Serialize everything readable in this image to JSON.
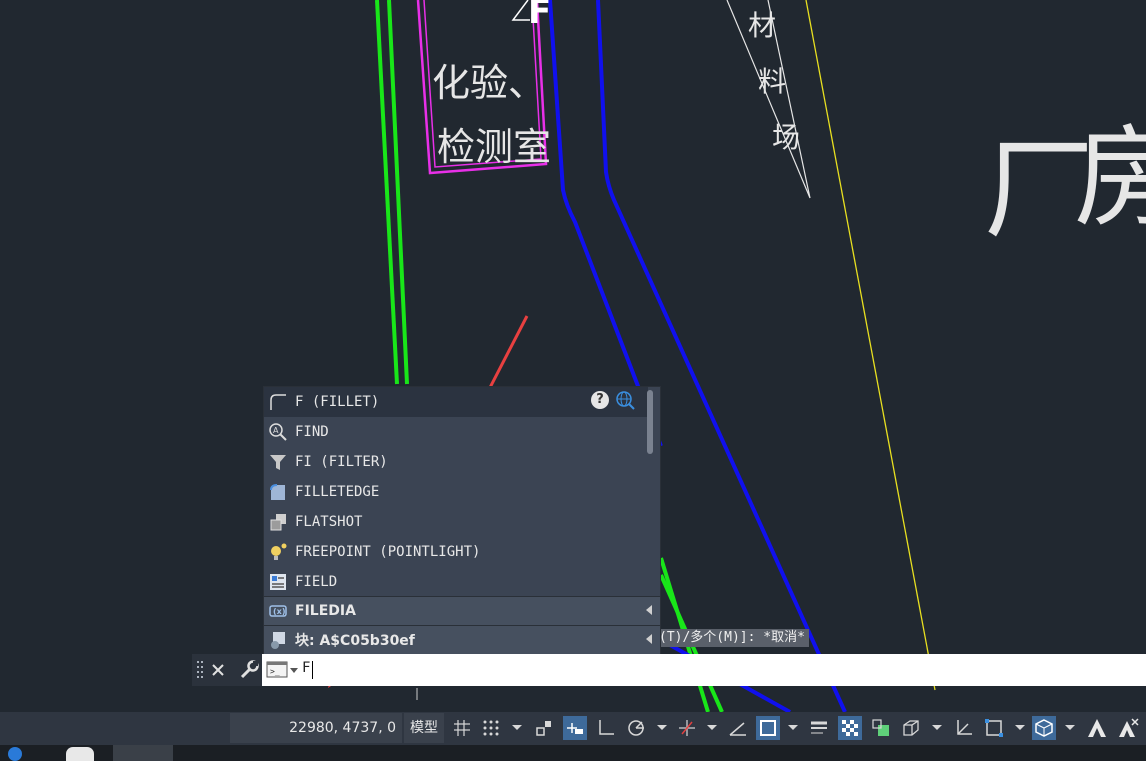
{
  "drawing": {
    "labels": {
      "lab_line1": "化验、",
      "lab_line2": "检测室",
      "material_1": "材",
      "material_2": "料",
      "material_3": "场",
      "factory_1": "厂",
      "factory_2": "房",
      "top_glyph": "F"
    }
  },
  "autocomplete": {
    "items": [
      {
        "label": "F (FILLET)",
        "icon": "fillet-icon"
      },
      {
        "label": "FIND",
        "icon": "find-icon"
      },
      {
        "label": "FI (FILTER)",
        "icon": "filter-icon"
      },
      {
        "label": "FILLETEDGE",
        "icon": "filletedge-icon"
      },
      {
        "label": "FLATSHOT",
        "icon": "flatshot-icon"
      },
      {
        "label": "FREEPOINT (POINTLIGHT)",
        "icon": "pointlight-icon"
      },
      {
        "label": "FIELD",
        "icon": "field-icon"
      }
    ],
    "groups": [
      {
        "label": "FILEDIA",
        "icon": "system-variable-icon"
      },
      {
        "label": "块: A$C05b30ef",
        "icon": "block-icon"
      }
    ],
    "help": "?"
  },
  "command_line": {
    "input_value": "F",
    "prompt_tail": "(T)/多个(M)]: *取消*"
  },
  "status_bar": {
    "coordinates": "22980, 4737, 0",
    "model_tab": "模型"
  },
  "colors": {
    "background": "#212830",
    "green_wall": "#19e619",
    "blue_road": "#1010ee",
    "magenta_room": "#e830e8",
    "yellow_line": "#e8e020",
    "annotation_arrow": "#e84040"
  }
}
